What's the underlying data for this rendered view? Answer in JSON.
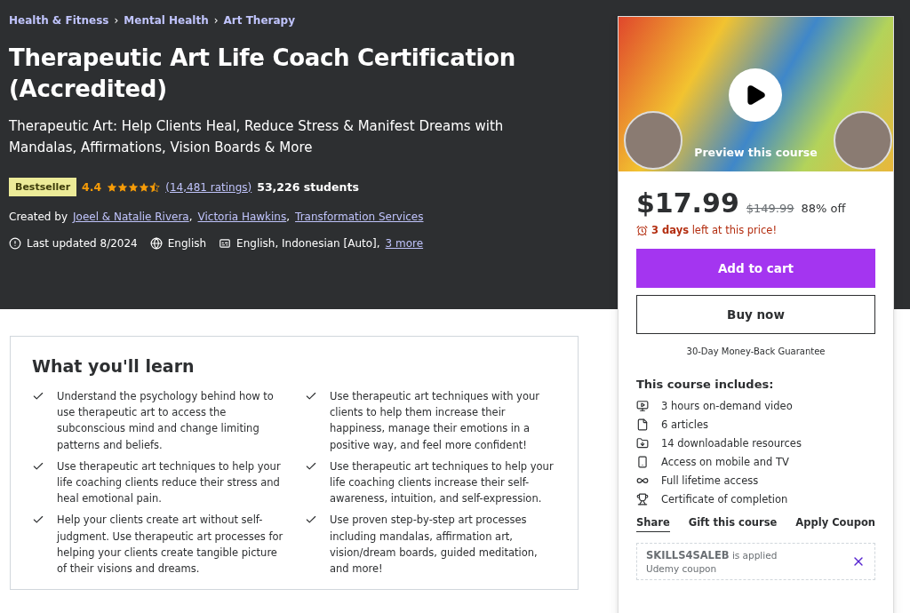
{
  "breadcrumbs": [
    "Health & Fitness",
    "Mental Health",
    "Art Therapy"
  ],
  "title": "Therapeutic Art Life Coach Certification (Accredited)",
  "subtitle": "Therapeutic Art: Help Clients Heal, Reduce Stress & Manifest Dreams with Mandalas, Affirmations, Vision Boards & More",
  "badge": "Bestseller",
  "rating": "4.4",
  "stars": 4.5,
  "ratings_link": "(14,481 ratings)",
  "students": "53,226 students",
  "created_by": "Created by",
  "instructors": [
    {
      "name": "Joeel & Natalie Rivera",
      "sep": ","
    },
    {
      "name": "Victoria Hawkins",
      "sep": ","
    },
    {
      "name": "Transformation Services"
    }
  ],
  "crumb_sep": "›",
  "meta": [
    {
      "kind": "updated",
      "text": "Last updated 8/2024"
    },
    {
      "kind": "language",
      "text": "English"
    },
    {
      "kind": "captions",
      "text": "English, Indonesian [Auto],",
      "link": "3 more"
    }
  ],
  "preview": {
    "label": "Preview this course"
  },
  "price": "$17.99",
  "old_price": "$149.99",
  "discount": "88% off",
  "deadline": "**3 days** left at this price!",
  "buttons": [
    "Add to cart",
    "Buy now"
  ],
  "guarantee": "30-Day Money-Back Guarantee",
  "includes_title": "This course includes:",
  "includes": [
    {
      "kind": "video",
      "text": "3 hours on-demand video"
    },
    {
      "kind": "article",
      "text": "6 articles"
    },
    {
      "kind": "download",
      "text": "14 downloadable resources"
    },
    {
      "kind": "mobile",
      "text": "Access on mobile and TV"
    },
    {
      "kind": "lifetime",
      "text": "Full lifetime access"
    },
    {
      "kind": "certificate",
      "text": "Certificate of completion"
    }
  ],
  "actions": [
    {
      "label": "Share",
      "selected": true
    },
    {
      "label": "Gift this course",
      "selected": false
    },
    {
      "label": "Apply Coupon",
      "selected": false
    }
  ],
  "coupon": {
    "status": "**SKILLS4SALEB** is applied",
    "note": "Udemy coupon"
  },
  "learn": {
    "title": "What you'll learn",
    "items": [
      "Understand the psychology behind how to use therapeutic art to access the subconscious mind and change limiting patterns and beliefs.",
      "Use therapeutic art techniques with your clients to help them increase their happiness, manage their emotions in a positive way, and feel more confident!",
      "Use therapeutic art techniques to help your life coaching clients reduce their stress and heal emotional pain.",
      "Use therapeutic art techniques to help your life coaching clients increase their self-awareness, intuition, and self-expression.",
      "Help your clients create art without self-judgment. Use therapeutic art processes for helping your clients create tangible picture of their visions and dreams.",
      "Use proven step-by-step art processes including mandalas, affirmation art, vision/dream boards, guided meditation, and more!"
    ]
  }
}
